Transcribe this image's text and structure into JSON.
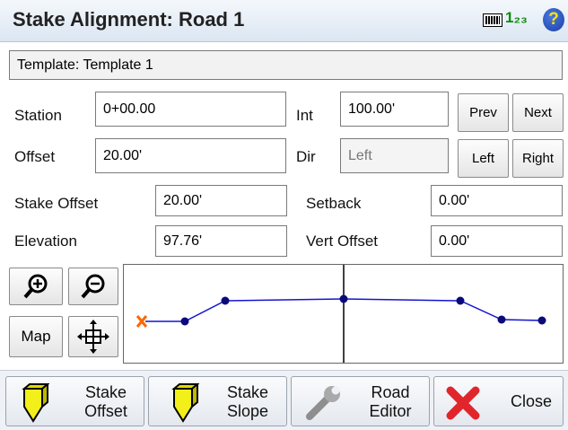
{
  "window": {
    "title": "Stake Alignment: Road 1",
    "input_mode_label": "1₂₃",
    "help_label": "?"
  },
  "template_field": {
    "value": "Template: Template 1"
  },
  "station": {
    "label": "Station",
    "value": "0+00.00"
  },
  "int": {
    "label": "Int",
    "value": "100.00'"
  },
  "offset": {
    "label": "Offset",
    "value": "20.00'"
  },
  "dir": {
    "label": "Dir",
    "value": "Left"
  },
  "nav_buttons": {
    "prev": "Prev",
    "next": "Next",
    "left": "Left",
    "right": "Right"
  },
  "stake_offset": {
    "label": "Stake Offset",
    "value": "20.00'"
  },
  "setback": {
    "label": "Setback",
    "value": "0.00'"
  },
  "elevation": {
    "label": "Elevation",
    "value": "97.76'"
  },
  "vert_offset": {
    "label": "Vert Offset",
    "value": "0.00'"
  },
  "view_tools": {
    "map_label": "Map"
  },
  "toolbar": {
    "stake_offset": [
      "Stake",
      "Offset"
    ],
    "stake_slope": [
      "Stake",
      "Slope"
    ],
    "road_editor": [
      "Road",
      "Editor"
    ],
    "close": "Close"
  },
  "colors": {
    "profile_line": "#1414d2",
    "target_marker": "#ff6600",
    "centerline": "#000000",
    "close_x": "#e0262a"
  },
  "icons": [
    "keyboard-icon",
    "help-icon",
    "zoom-in-icon",
    "zoom-out-icon",
    "pan-icon",
    "stake-icon",
    "wrench-icon",
    "close-icon"
  ]
}
